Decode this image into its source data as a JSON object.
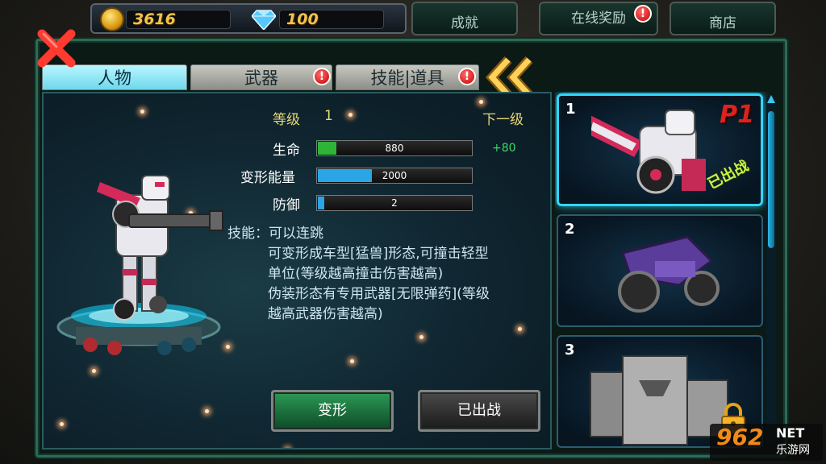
{
  "topbar": {
    "coins": "3616",
    "gems": "100",
    "achievements_label": "成就",
    "online_reward_label": "在线奖励",
    "shop_label": "商店",
    "alert_mark": "!"
  },
  "tabs": [
    {
      "label": "人物",
      "active": true
    },
    {
      "label": "武器",
      "alert": true
    },
    {
      "label": "技能|道具",
      "alert": true
    }
  ],
  "stats": {
    "level_label": "等级",
    "level_value": "1",
    "next_level_label": "下一级",
    "rows": [
      {
        "label": "生命",
        "value": "880",
        "fill": 0.12,
        "color": "#2fb43a",
        "bonus": "+80"
      },
      {
        "label": "变形能量",
        "value": "2000",
        "fill": 0.35,
        "color": "#2aa6e6"
      },
      {
        "label": "防御",
        "value": "2",
        "fill": 0.04,
        "color": "#2aa6e6"
      }
    ]
  },
  "skill": {
    "lines": [
      "技能：可以连跳",
      "可变形成车型[猛兽]形态,可撞击轻型",
      "单位(等级越高撞击伤害越高)",
      "伪装形态有专用武器[无限弹药](等级",
      "越高武器伤害越高)"
    ]
  },
  "actions": {
    "transform_label": "变形",
    "deployed_label": "已出战"
  },
  "characters": [
    {
      "number": "1",
      "tag": "P1",
      "status": "已出战",
      "selected": true
    },
    {
      "number": "2",
      "selected": false
    },
    {
      "number": "3",
      "selected": false,
      "locked": true
    }
  ],
  "watermark": {
    "number": "962",
    "domain": "NET",
    "site": "乐游网"
  },
  "colors": {
    "accent": "#33d6ff",
    "frame": "#2f6a55",
    "level_text": "#e8d774",
    "bonus_text": "#3fd86a",
    "p1_red": "#e0221c"
  }
}
